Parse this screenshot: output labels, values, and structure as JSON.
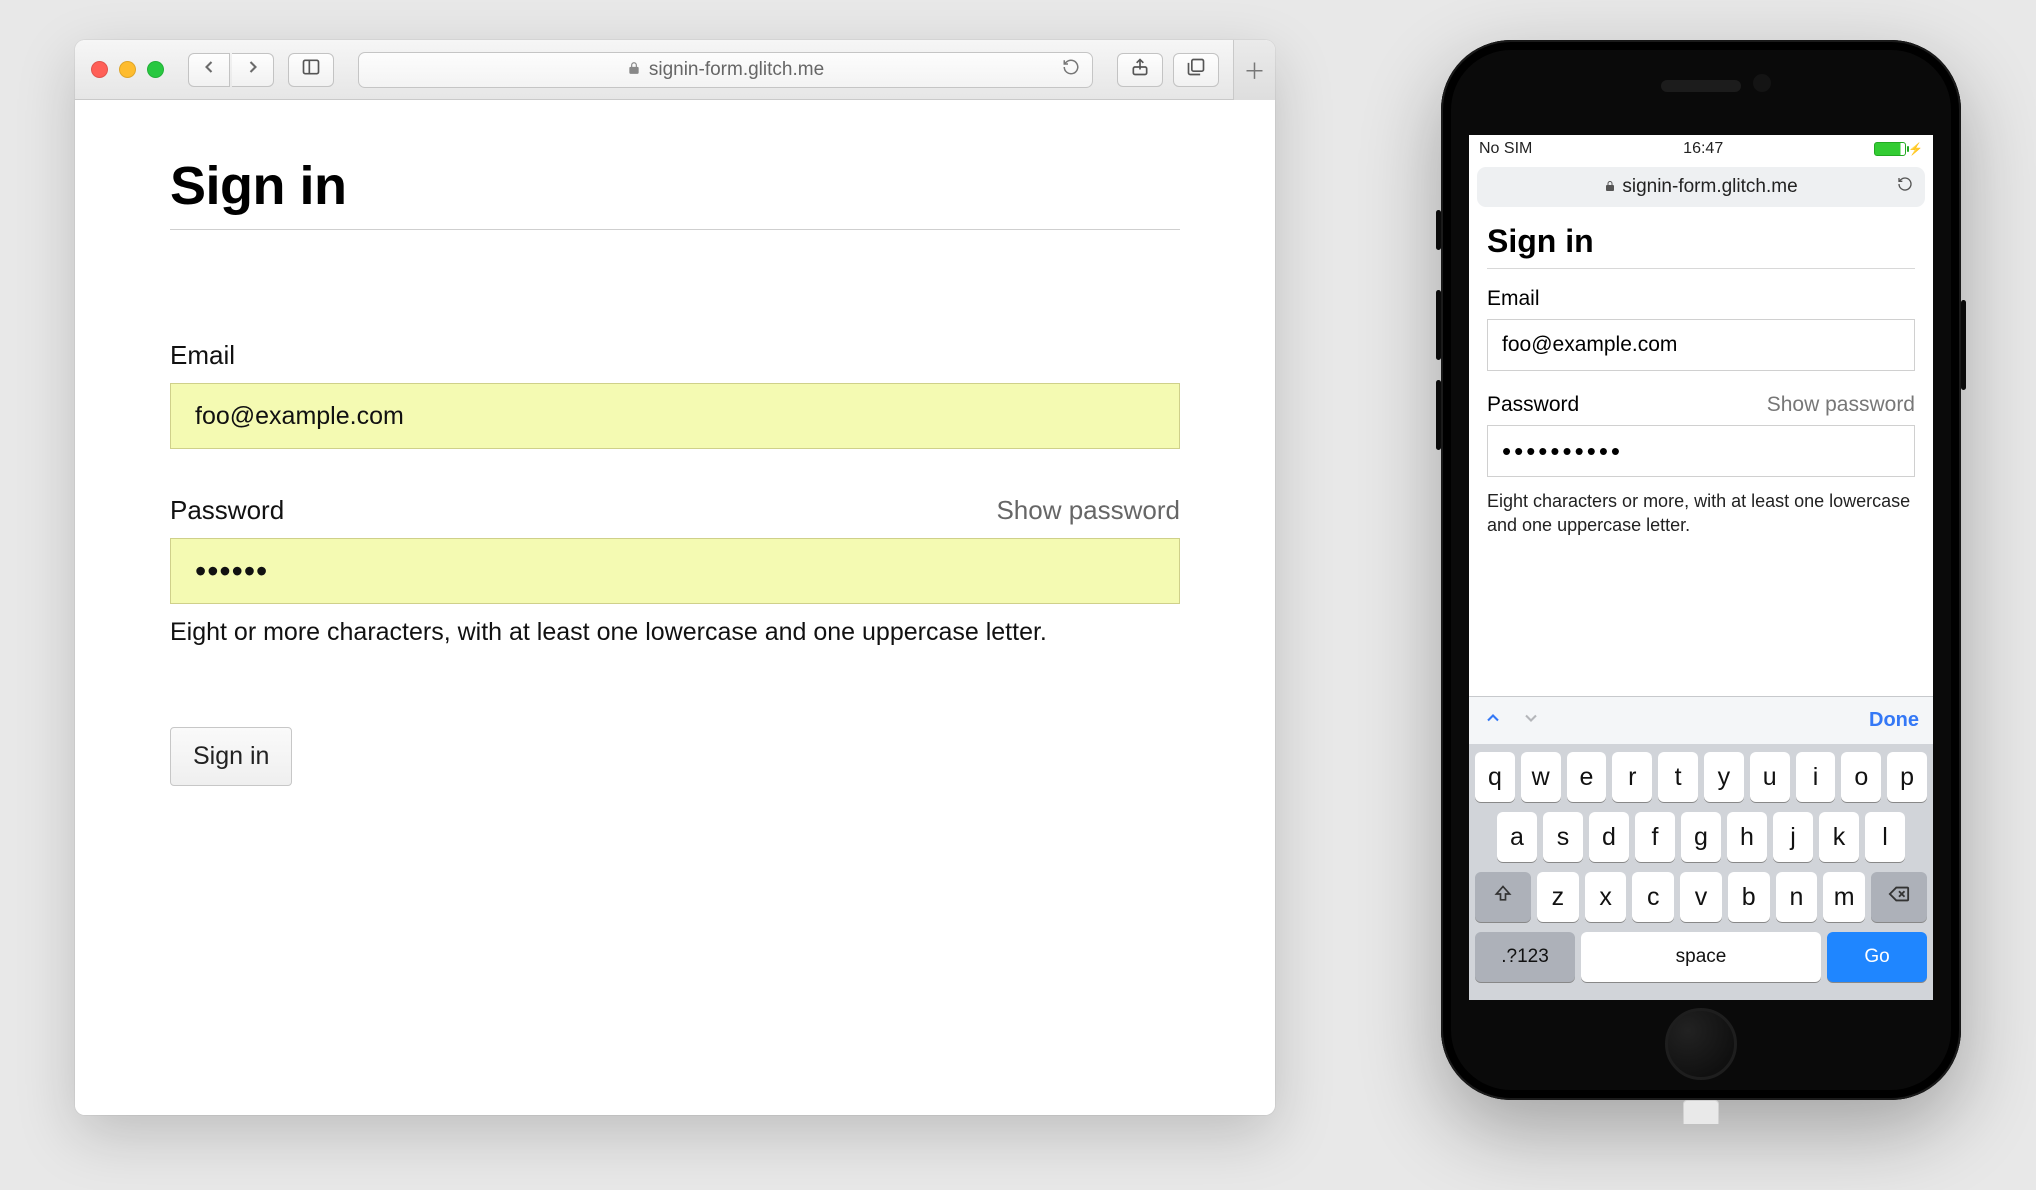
{
  "desktop": {
    "url": "signin-form.glitch.me",
    "page": {
      "title": "Sign in",
      "email_label": "Email",
      "email_value": "foo@example.com",
      "password_label": "Password",
      "show_password": "Show password",
      "password_masked": "••••••",
      "hint": "Eight or more characters, with at least one lowercase and one uppercase letter.",
      "submit": "Sign in"
    }
  },
  "phone": {
    "status": {
      "carrier": "No SIM",
      "time": "16:47"
    },
    "url": "signin-form.glitch.me",
    "page": {
      "title": "Sign in",
      "email_label": "Email",
      "email_value": "foo@example.com",
      "password_label": "Password",
      "show_password": "Show password",
      "password_masked": "••••••••••",
      "hint": "Eight characters or more, with at least one lowercase and one uppercase letter."
    },
    "keyboard": {
      "done": "Done",
      "row1": [
        "q",
        "w",
        "e",
        "r",
        "t",
        "y",
        "u",
        "i",
        "o",
        "p"
      ],
      "row2": [
        "a",
        "s",
        "d",
        "f",
        "g",
        "h",
        "j",
        "k",
        "l"
      ],
      "row3": [
        "z",
        "x",
        "c",
        "v",
        "b",
        "n",
        "m"
      ],
      "numkey": ".?123",
      "space": "space",
      "go": "Go"
    }
  }
}
